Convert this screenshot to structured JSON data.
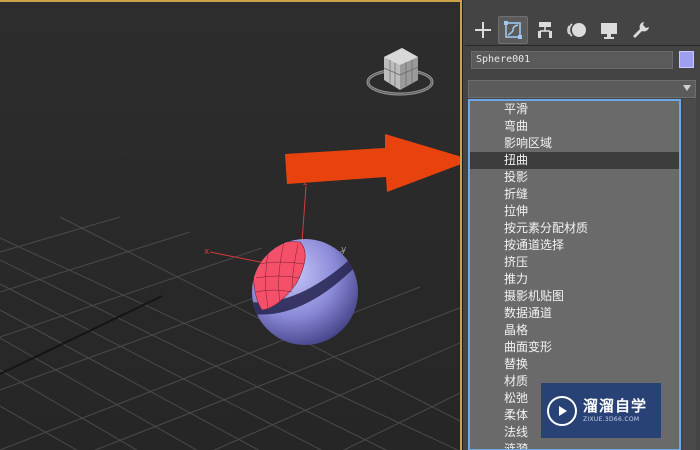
{
  "object_name": "Sphere001",
  "object_color": "#9f9ff0",
  "accent_color": "#6fa8e6",
  "arrow_color": "#e8430f",
  "tabs": [
    {
      "name": "create",
      "icon": "plus-icon"
    },
    {
      "name": "modify",
      "icon": "modify-icon",
      "active": true
    },
    {
      "name": "hierarchy",
      "icon": "hierarchy-icon"
    },
    {
      "name": "motion",
      "icon": "motion-icon"
    },
    {
      "name": "display",
      "icon": "display-icon"
    },
    {
      "name": "utilities",
      "icon": "wrench-icon"
    }
  ],
  "modifier_list": {
    "selected_value": "",
    "items": [
      "平滑",
      "弯曲",
      "影响区域",
      "扭曲",
      "投影",
      "折缝",
      "拉伸",
      "按元素分配材质",
      "按通道选择",
      "挤压",
      "推力",
      "摄影机贴图",
      "数据通道",
      "晶格",
      "曲面变形",
      "替换",
      "材质",
      "松弛",
      "柔体",
      "法线",
      "涟漪"
    ],
    "highlighted_index": 3
  },
  "watermark": {
    "title": "溜溜自学",
    "url": "ZIXUE.3D66.COM"
  }
}
